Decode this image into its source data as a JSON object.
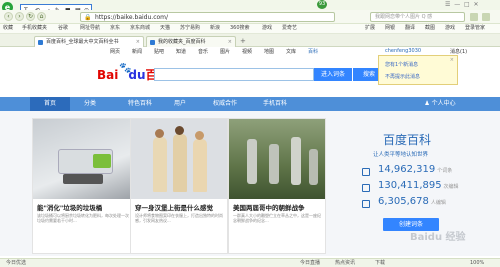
{
  "browser": {
    "top_right_search_placeholder": "我跟网恋带个人图片 Q 感",
    "url": "https://baike.baidu.com/",
    "badge_count": "93",
    "overlay_tool_label": "T",
    "favorites": [
      "收藏",
      "手机收藏夹",
      "谷歌",
      "网址导航",
      "京东",
      "京东商城",
      "天猫",
      "苏宁易购",
      "新浪",
      "360搜索",
      "游戏",
      "爱奇艺"
    ],
    "favorites_right": [
      "扩展",
      "网银",
      "翻译",
      "截图",
      "游戏",
      "登录管家"
    ],
    "tabs": [
      {
        "label": "百度百科_全球最大中文百科全书",
        "active": true
      },
      {
        "label": "我的收藏夹_百度百科",
        "active": false
      }
    ],
    "status_left": "今日优选",
    "status_right": [
      "今日直播",
      "热点资讯",
      "下载",
      "100%"
    ]
  },
  "baike_header": {
    "top_links": [
      "网页",
      "新闻",
      "贴吧",
      "知道",
      "音乐",
      "图片",
      "视频",
      "地图",
      "文库",
      "百科"
    ],
    "user_name": "chenfeng3030",
    "message_label": "消息(1)",
    "logo_bai": "Bai",
    "logo_du": "du",
    "logo_baike": "百科",
    "enter_button": "进入词条",
    "search_button": "搜索"
  },
  "popup": {
    "line1": "您有1个新消息",
    "line2": "不再提示此消息",
    "close": "×"
  },
  "nav": {
    "items": [
      "首页",
      "分类",
      "特色百科",
      "用户",
      "权威合作",
      "手机百科"
    ],
    "personal_center": "个人中心"
  },
  "cards": [
    {
      "title": "能\"消化\"垃圾的垃圾桶",
      "text": "该垃圾桶可以将厨余垃圾转化为肥料，每次处理一次垃圾约需要若干小时..."
    },
    {
      "title": "穿一身汉堡上街是什么感觉",
      "text": "设计师将食物图案印在衣服上，打造出独特的时尚感，引发网友热议..."
    },
    {
      "title": "美国两届哥中的朝鲜战争",
      "text": "一群真人大小的雕塑伫立在草丛之中，这是一座纪念朝鲜战争的纪念..."
    }
  ],
  "sidebar": {
    "title": "百度百科",
    "subtitle": "让人类平等地认知世界",
    "stats": [
      {
        "value": "14,962,319",
        "unit": "个词条"
      },
      {
        "value": "130,411,895",
        "unit": "次编辑"
      },
      {
        "value": "6,305,678",
        "unit": "人编辑"
      }
    ],
    "create_button": "创建词条",
    "watermark": "Baidu 经验"
  },
  "colors": {
    "accent_green": "#27a33a",
    "baidu_blue": "#3385ff",
    "baike_blue": "#2a6bb7",
    "nav_blue": "#4e8fd8"
  }
}
